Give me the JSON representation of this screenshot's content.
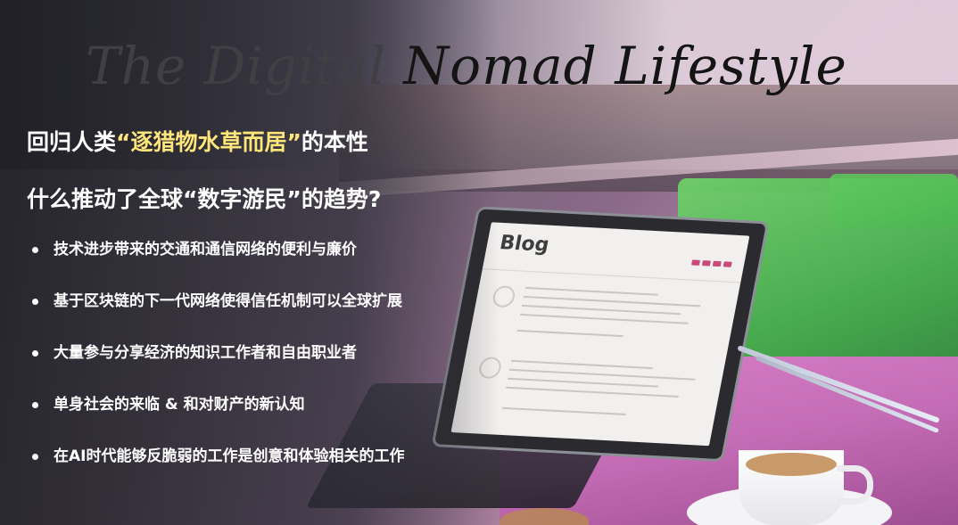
{
  "title": {
    "part1": "The Digital ",
    "part2": "Nomad Lifestyle"
  },
  "heading1": {
    "prefix": "回归人类",
    "highlight": "“逐猎物水草而居”",
    "suffix": "的本性"
  },
  "heading2": "什么推动了全球“数字游民”的趋势?",
  "bullets": [
    "技术进步带来的交通和通信网络的便利与廉价",
    "基于区块链的下一代网络使得信任机制可以全球扩展",
    "大量参与分享经济的知识工作者和自由职业者",
    "单身社会的来临 & 和对财产的新认知",
    "在AI时代能够反脆弱的工作是创意和体验相关的工作"
  ],
  "laptop_screen": {
    "heading": "Blog"
  },
  "colors": {
    "highlight": "#ffe67a",
    "text": "#ffffff",
    "cushion": "#3fae48",
    "table": "#c56cb6"
  }
}
